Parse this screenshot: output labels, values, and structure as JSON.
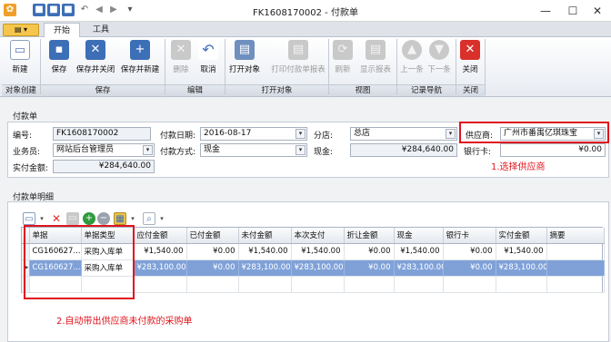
{
  "window": {
    "title": "FK1608170002 - 付款单"
  },
  "tabs": [
    {
      "label": "开始",
      "active": true
    },
    {
      "label": "工具",
      "active": false
    }
  ],
  "ribbon": {
    "new": "新建",
    "save": "保存",
    "save_close": "保存并关闭",
    "save_new": "保存并新建",
    "delete": "删除",
    "cancel": "取消",
    "open_obj": "打开对象",
    "print_report": "打印付款单报表",
    "refresh": "刷新",
    "show_report": "显示报表",
    "prev": "上一条",
    "next": "下一条",
    "close": "关闭",
    "groups": {
      "object_create": "对象创建",
      "save": "保存",
      "edit": "编辑",
      "open_object": "打开对象",
      "view": "视图",
      "record_nav": "记录导航",
      "close": "关闭"
    }
  },
  "form": {
    "section_title": "付款单",
    "code_label": "编号:",
    "code_value": "FK1608170002",
    "date_label": "付款日期:",
    "date_value": "2016-08-17",
    "branch_label": "分店:",
    "branch_value": "总店",
    "supplier_label": "供应商:",
    "supplier_value": "广州市番禺亿琪珠宝",
    "clerk_label": "业务员:",
    "clerk_value": "网站后台管理员",
    "method_label": "付款方式:",
    "method_value": "现金",
    "cash_label": "现金:",
    "cash_value": "¥284,640.00",
    "card_label": "银行卡:",
    "card_value": "¥0.00",
    "paid_label": "实付金额:",
    "paid_value": "¥284,640.00"
  },
  "annotations": {
    "step1": "1.选择供应商",
    "step2": "2.自动带出供应商未付款的采购单"
  },
  "detail": {
    "section_title": "付款单明细",
    "columns": [
      "单据",
      "单据类型",
      "应付金额",
      "已付金额",
      "未付金额",
      "本次支付",
      "折让金额",
      "现金",
      "银行卡",
      "实付金额",
      "摘要"
    ],
    "rows": [
      [
        "CG160627...",
        "采购入库单",
        "¥1,540.00",
        "¥0.00",
        "¥1,540.00",
        "¥1,540.00",
        "¥0.00",
        "¥1,540.00",
        "¥0.00",
        "¥1,540.00",
        ""
      ],
      [
        "CG160627...",
        "采购入库单",
        "¥283,100.00",
        "¥0.00",
        "¥283,100.00",
        "¥283,100.00",
        "¥0.00",
        "¥283,100.00",
        "¥0.00",
        "¥283,100.00",
        ""
      ]
    ],
    "selected_row": 1
  },
  "colors": {
    "annotation_red": "#e0141d",
    "selection_blue": "#7fa1d8",
    "close_red": "#d9302b"
  }
}
